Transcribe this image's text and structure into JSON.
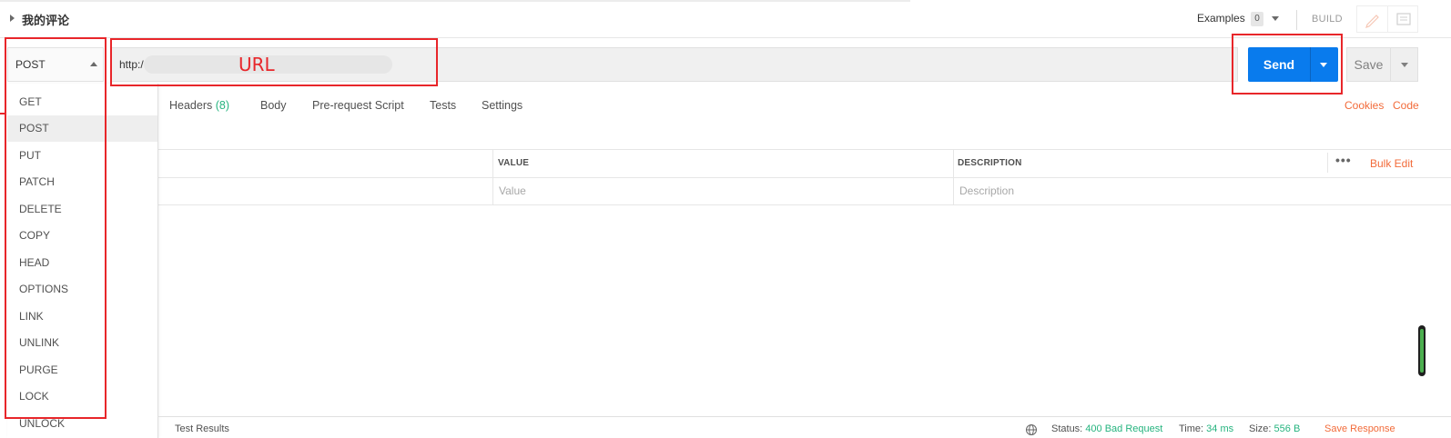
{
  "header": {
    "request_title": "我的评论",
    "examples_label": "Examples",
    "examples_count": "0",
    "build_label": "BUILD"
  },
  "request": {
    "method": "POST",
    "url_value": "http:/",
    "url_annotation": "URL",
    "send_label": "Send",
    "save_label": "Save"
  },
  "tabs": [
    {
      "label": "Headers",
      "count": "(8)"
    },
    {
      "label": "Body"
    },
    {
      "label": "Pre-request Script"
    },
    {
      "label": "Tests"
    },
    {
      "label": "Settings"
    }
  ],
  "right_links": {
    "cookies": "Cookies",
    "code": "Code"
  },
  "table": {
    "columns": [
      "VALUE",
      "DESCRIPTION"
    ],
    "placeholders": {
      "value": "Value",
      "description": "Description"
    },
    "more_icon": "more-horizontal-icon",
    "bulk_edit": "Bulk Edit"
  },
  "methods_dropdown": {
    "items": [
      "GET",
      "POST",
      "PUT",
      "PATCH",
      "DELETE",
      "COPY",
      "HEAD",
      "OPTIONS",
      "LINK",
      "UNLINK",
      "PURGE",
      "LOCK",
      "UNLOCK"
    ],
    "active": "POST"
  },
  "bottom": {
    "test_results": "Test Results",
    "status_label": "Status:",
    "status_value": "400 Bad Request",
    "time_label": "Time:",
    "time_value": "34 ms",
    "size_label": "Size:",
    "size_value": "556 B",
    "save_response": "Save Response"
  },
  "colors": {
    "primary": "#097bed",
    "accent": "#f26b3a",
    "success": "#26b47f",
    "annotation": "#e8262a"
  }
}
